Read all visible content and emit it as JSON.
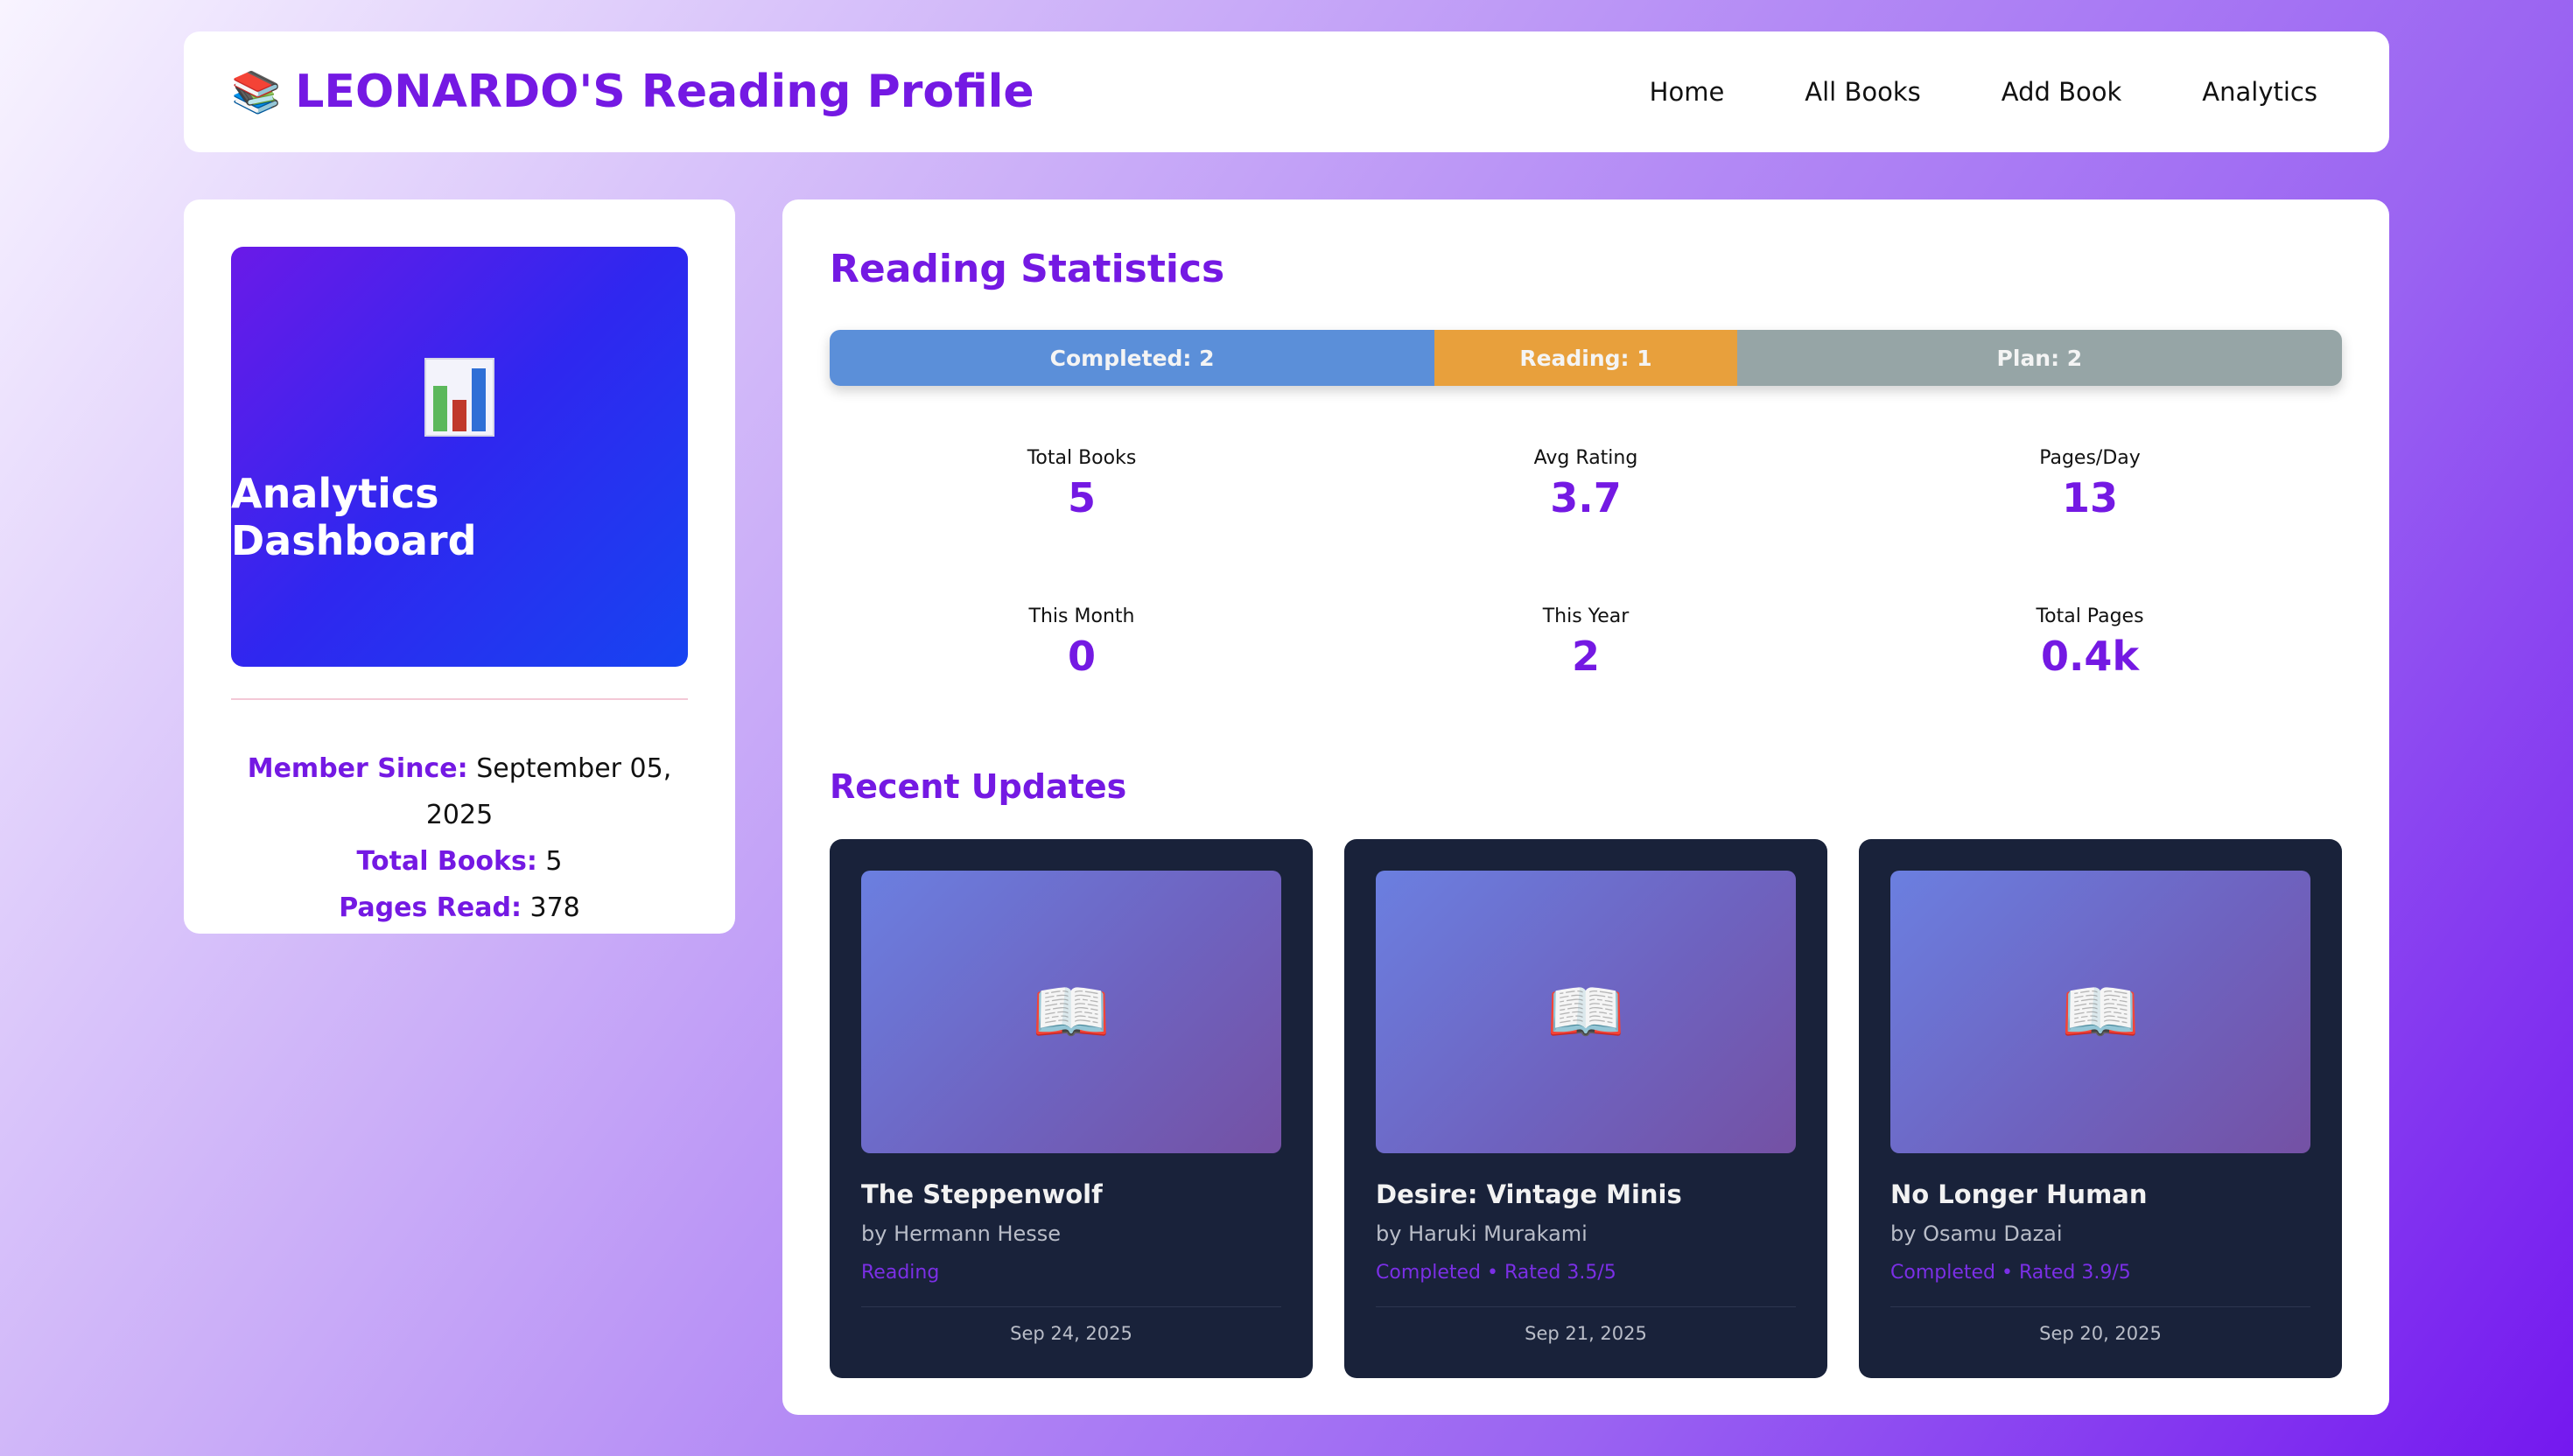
{
  "header": {
    "logo_icon": "books-emoji",
    "logo_glyph": "📚",
    "title": "LEONARDO'S Reading Profile",
    "nav": [
      "Home",
      "All Books",
      "Add Book",
      "Analytics"
    ]
  },
  "profile": {
    "hero_icon": "bar-chart-icon",
    "hero_title": "Analytics Dashboard",
    "member_since_label": "Member Since:",
    "member_since_value": "September 05, 2025",
    "total_books_label": "Total Books:",
    "total_books_value": "5",
    "pages_read_label": "Pages Read:",
    "pages_read_value": "378"
  },
  "stats": {
    "heading": "Reading Statistics",
    "bar": [
      {
        "label": "Completed: 2",
        "count": 2,
        "color": "#5b8fd9"
      },
      {
        "label": "Reading: 1",
        "count": 1,
        "color": "#e8a03c"
      },
      {
        "label": "Plan: 2",
        "count": 2,
        "color": "#96a5a6"
      }
    ],
    "items": [
      {
        "label": "Total Books",
        "value": "5"
      },
      {
        "label": "Avg Rating",
        "value": "3.7"
      },
      {
        "label": "Pages/Day",
        "value": "13"
      },
      {
        "label": "This Month",
        "value": "0"
      },
      {
        "label": "This Year",
        "value": "2"
      },
      {
        "label": "Total Pages",
        "value": "0.4k"
      }
    ]
  },
  "recent": {
    "heading": "Recent Updates",
    "cards": [
      {
        "title": "The Steppenwolf",
        "author": "by Hermann Hesse",
        "status": "Reading",
        "date": "Sep 24, 2025"
      },
      {
        "title": "Desire: Vintage Minis",
        "author": "by Haruki Murakami",
        "status": "Completed • Rated 3.5/5",
        "date": "Sep 21, 2025"
      },
      {
        "title": "No Longer Human",
        "author": "by Osamu Dazai",
        "status": "Completed • Rated 3.9/5",
        "date": "Sep 20, 2025"
      }
    ],
    "cover_icon": "open-book-icon",
    "cover_glyph": "📖"
  },
  "colors": {
    "accent": "#7419e3",
    "card_bg": "#19223a"
  }
}
